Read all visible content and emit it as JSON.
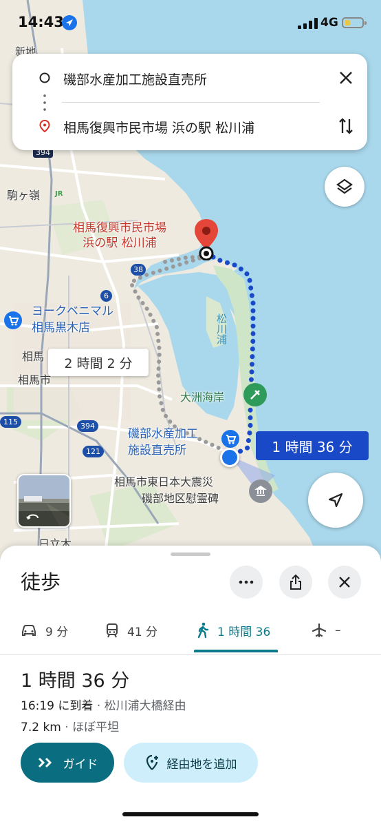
{
  "status_bar": {
    "time": "14:43",
    "network": "4G"
  },
  "route": {
    "origin": "磯部水産加工施設直売所",
    "destination": "相馬復興市民市場 浜の駅 松川浦"
  },
  "map": {
    "labels": {
      "dest_line1": "相馬復興市民市場",
      "dest_line2": "浜の駅 松川浦",
      "york_line1": "ヨークベニマル",
      "york_line2": "相馬黒木店",
      "komagamine": "駒ヶ嶺",
      "soma_partial": "相馬",
      "soma_city_partial": "相馬市",
      "matsukawaura": "松川浦",
      "ozu_beach": "大洲海岸",
      "origin_line1": "磯部水産加工",
      "origin_line2": "施設直売所",
      "memorial_line1": "相馬市東日本大震災",
      "memorial_line2": "磯部地区慰霊碑",
      "hitachigi": "日立木",
      "shinchi_partial": "新地"
    },
    "road_shields": [
      "394",
      "38",
      "6",
      "115",
      "394",
      "121"
    ],
    "jr_badge": "JR",
    "alt_route_duration": "2 時間 2 分",
    "route_duration": "1 時間 36 分"
  },
  "sheet": {
    "title": "徒歩",
    "modes": [
      {
        "name": "car",
        "label": "9 分"
      },
      {
        "name": "transit",
        "label": "41 分"
      },
      {
        "name": "walk",
        "label": "1 時間 36"
      },
      {
        "name": "flight",
        "label": "–"
      }
    ],
    "selected_mode": "walk",
    "summary": {
      "duration": "1 時間 36 分",
      "arrival": "16:19 に到着",
      "via": "· 松川浦大橋経由",
      "distance": "7.2 km",
      "terrain": "· ほぼ平坦"
    },
    "buttons": {
      "guide": "ガイド",
      "add_stop": "経由地を追加"
    }
  },
  "colors": {
    "route_blue": "#1a49c8",
    "accent_teal": "#0b7a8a",
    "water": "#a9d8ec"
  }
}
